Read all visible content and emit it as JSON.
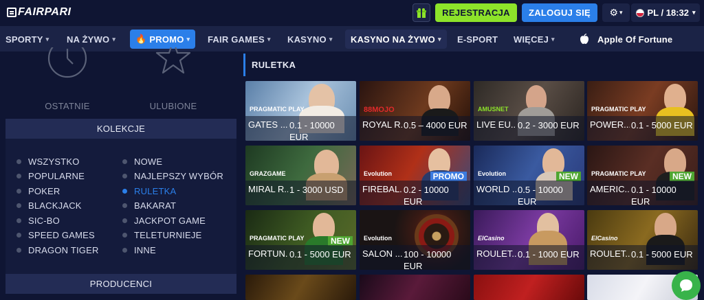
{
  "header": {
    "logo_text": "FAIRPARI",
    "register_label": "REJESTRACJA",
    "login_label": "ZALOGUJ SIĘ",
    "lang_time": "PL / 18:32",
    "gift_icon": "gift-icon",
    "settings_icon": "gear-icon"
  },
  "nav": {
    "items": [
      {
        "label": "SPORTY",
        "chev": "▾"
      },
      {
        "label": "NA ŻYWO",
        "chev": "▾"
      },
      {
        "label": "PROMO",
        "chev": "▾"
      },
      {
        "label": "FAIR GAMES",
        "chev": "▾"
      },
      {
        "label": "KASYNO",
        "chev": "▾"
      },
      {
        "label": "KASYNO NA ŻYWO",
        "chev": "▾"
      },
      {
        "label": "E-SPORT",
        "chev": ""
      },
      {
        "label": "WIĘCEJ",
        "chev": "▾"
      },
      {
        "label": "Apple Of Fortune",
        "chev": ""
      }
    ]
  },
  "sidebar": {
    "recent_label": "OSTATNIE",
    "favorites_label": "ULUBIONE",
    "collections_title": "KOLEKCJE",
    "collections_left": [
      "WSZYSTKO",
      "POPULARNE",
      "POKER",
      "BLACKJACK",
      "SIC-BO",
      "SPEED GAMES",
      "DRAGON TIGER"
    ],
    "collections_right": [
      "NOWE",
      "NAJLEPSZY WYBÓR",
      "RULETKA",
      "BAKARAT",
      "JACKPOT GAME",
      "TELETURNIEJE",
      "INNE"
    ],
    "selected": "RULETKA",
    "providers_title": "PRODUCENCI"
  },
  "main": {
    "title": "RULETKA",
    "games": [
      {
        "name": "GATES ...",
        "range": "0.1 - 10000 EUR",
        "provider": "PRAGMATIC PLAY",
        "badge": ""
      },
      {
        "name": "ROYAL R...",
        "range": "0.5 – 4000 EUR",
        "provider": "88MOJO",
        "badge": ""
      },
      {
        "name": "LIVE EU...",
        "range": "0.2 - 3000 EUR",
        "provider": "AMUSNET",
        "badge": ""
      },
      {
        "name": "POWER...",
        "range": "0.1 - 5000 EUR",
        "provider": "PRAGMATIC PLAY",
        "badge": ""
      },
      {
        "name": "MIRAL R...",
        "range": "1 - 3000 USD",
        "provider": "GRAZGAME",
        "badge": ""
      },
      {
        "name": "FIREBAL...",
        "range": "0.2 - 10000 EUR",
        "provider": "Evolution",
        "badge": "PROMO"
      },
      {
        "name": "WORLD ...",
        "range": "0.5 - 10000 EUR",
        "provider": "Evolution",
        "badge": "NEW"
      },
      {
        "name": "AMERIC...",
        "range": "0.1 - 10000 EUR",
        "provider": "PRAGMATIC PLAY",
        "badge": "NEW"
      },
      {
        "name": "FORTUN...",
        "range": "0.1 - 5000 EUR",
        "provider": "PRAGMATIC PLAY",
        "badge": "NEW"
      },
      {
        "name": "SALON ...",
        "range": "100 - 10000 EUR",
        "provider": "Evolution",
        "badge": ""
      },
      {
        "name": "ROULET...",
        "range": "0.1 - 1000 EUR",
        "provider": "ElCasino",
        "badge": ""
      },
      {
        "name": "ROULET...",
        "range": "0.1 - 5000 EUR",
        "provider": "ElCasino",
        "badge": ""
      }
    ]
  },
  "chat_icon": "chat-bubble-icon"
}
